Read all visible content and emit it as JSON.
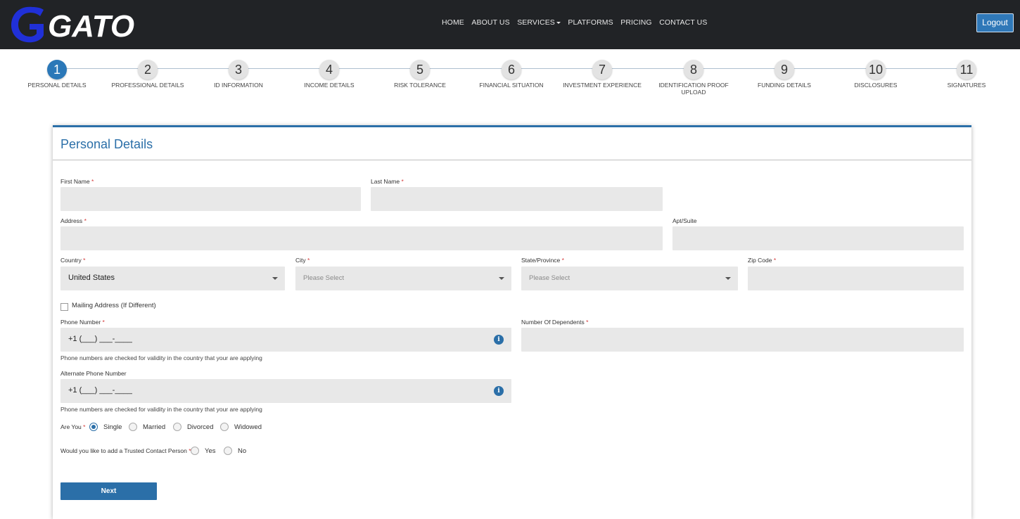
{
  "header": {
    "logo_text": "GATO",
    "nav": [
      "HOME",
      "ABOUT US",
      "SERVICES",
      "PLATFORMS",
      "PRICING",
      "CONTACT US"
    ],
    "logout_label": "Logout"
  },
  "stepper": {
    "steps": [
      {
        "number": "1",
        "label": "PERSONAL DETAILS"
      },
      {
        "number": "2",
        "label": "PROFESSIONAL DETAILS"
      },
      {
        "number": "3",
        "label": "ID INFORMATION"
      },
      {
        "number": "4",
        "label": "INCOME DETAILS"
      },
      {
        "number": "5",
        "label": "RISK TOLERANCE"
      },
      {
        "number": "6",
        "label": "FINANCIAL SITUATION"
      },
      {
        "number": "7",
        "label": "INVESTMENT EXPERIENCE"
      },
      {
        "number": "8",
        "label": "IDENTIFICATION PROOF UPLOAD"
      },
      {
        "number": "9",
        "label": "FUNDING DETAILS"
      },
      {
        "number": "10",
        "label": "DISCLOSURES"
      },
      {
        "number": "11",
        "label": "SIGNATURES"
      }
    ],
    "active": "1"
  },
  "form": {
    "title": "Personal Details",
    "first_name_label": "First Name",
    "last_name_label": "Last Name",
    "address_label": "Address",
    "apt_label": "Apt/Suite",
    "country_label": "Country",
    "country_value": "United States",
    "city_label": "City",
    "city_placeholder": "Please Select",
    "state_label": "State/Province",
    "state_placeholder": "Please Select",
    "zip_label": "Zip Code",
    "mailing_label": "Mailing Address (If Different)",
    "phone_label": "Phone Number",
    "phone_value": "+1 (___) ___-____",
    "phone_hint": "Phone numbers are checked for validity in the country that your are applying",
    "dependents_label": "Number Of Dependents",
    "alt_phone_label": "Alternate Phone Number",
    "alt_phone_value": "+1 (___) ___-____",
    "alt_phone_hint": "Phone numbers are checked for validity in the country that your are applying",
    "marital_label": "Are You",
    "marital_options": [
      "Single",
      "Married",
      "Divorced",
      "Widowed"
    ],
    "marital_selected": "Single",
    "trusted_label": "Would you like to add a Trusted Contact Person",
    "trusted_options": [
      "Yes",
      "No"
    ],
    "required_mark": "*",
    "info_glyph": "i",
    "next_label": "Next"
  },
  "colors": {
    "accent": "#2b6fa8",
    "header_bg": "#212326",
    "field_bg": "#e8e8e8",
    "required": "#d43a3a"
  }
}
